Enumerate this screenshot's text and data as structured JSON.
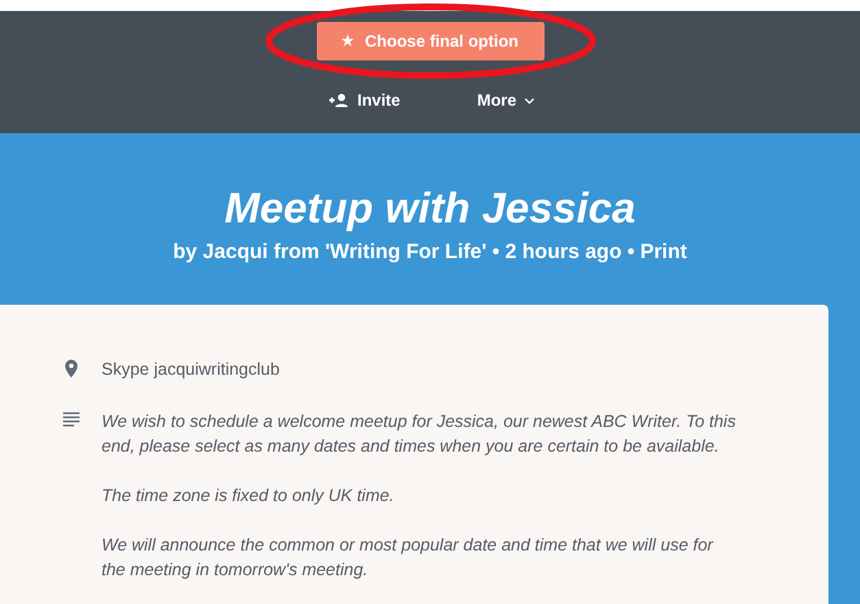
{
  "toolbar": {
    "primary_button": {
      "icon": "★",
      "label": "Choose final option"
    },
    "actions": [
      {
        "kind": "invite",
        "label": "Invite"
      },
      {
        "kind": "more",
        "label": "More"
      }
    ]
  },
  "header": {
    "title": "Meetup with Jessica",
    "byline": "by Jacqui from 'Writing For Life' • 2 hours ago •",
    "print_link": "Print"
  },
  "details": {
    "location": "Skype jacquiwritingclub",
    "description": [
      "We wish to schedule a welcome meetup for Jessica, our newest ABC Writer. To this end, please select as many dates and times when you are certain to be available.",
      "The time zone is fixed to only UK time.",
      "We will announce the common or most popular date and time that we will use for the meeting in tomorrow's meeting."
    ]
  }
}
